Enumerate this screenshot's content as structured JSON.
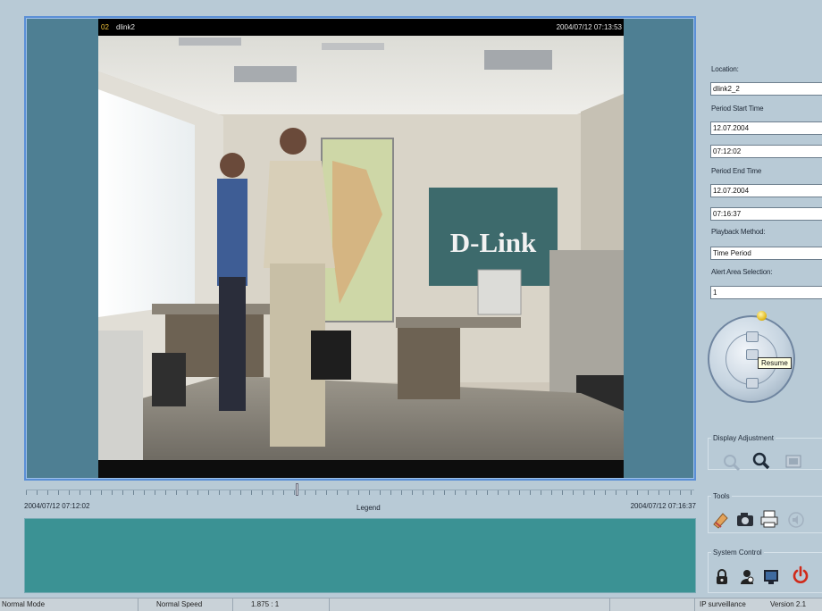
{
  "video": {
    "camera_number": "02",
    "camera_name": "dlink2",
    "timestamp": "2004/07/12 07:13:53",
    "banner_text": "D-Link"
  },
  "timeline": {
    "start_label": "2004/07/12 07:12:02",
    "legend_label": "Legend",
    "end_label": "2004/07/12 07:16:37"
  },
  "panel": {
    "location_label": "Location:",
    "location_value": "dlink2_2",
    "start_label": "Period Start Time",
    "start_date": "12.07.2004",
    "start_time": "07:12:02",
    "end_label": "Period End Time",
    "end_date": "12.07.2004",
    "end_time": "07:16:37",
    "playback_label": "Playback Method:",
    "playback_value": "Time Period",
    "alert_label": "Alert Area Selection:",
    "alert_value": "1",
    "tooltip": "Resume"
  },
  "groups": {
    "display_title": "Display Adjustment",
    "tools_title": "Tools",
    "system_title": "System Control"
  },
  "icons": {
    "display": [
      "zoom-out-icon",
      "zoom-in-icon",
      "fit-screen-icon"
    ],
    "tools": [
      "eraser-icon",
      "snapshot-camera-icon",
      "print-icon",
      "audio-icon"
    ],
    "system": [
      "lock-icon",
      "user-icon",
      "monitor-icon",
      "power-icon"
    ]
  },
  "status": {
    "mode": "Normal Mode",
    "speed": "Normal Speed",
    "ratio": "1.875 : 1",
    "app": "IP surveillance",
    "version": "Version 2.1"
  },
  "colors": {
    "panel_bg": "#b8cad6",
    "video_bg": "#4e7f93",
    "legend_bg": "#3b9294",
    "power_red": "#d02a1a",
    "led_yellow": "#e0b40f"
  }
}
